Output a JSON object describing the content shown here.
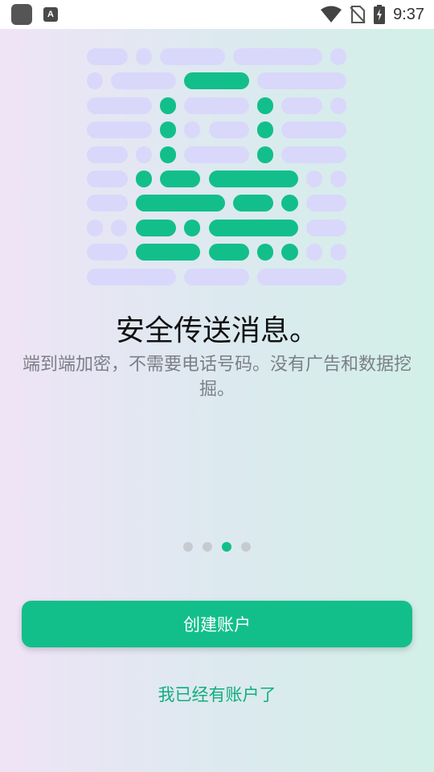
{
  "status_bar": {
    "time": "9:37",
    "icons": [
      "app-icon",
      "accessibility-icon",
      "wifi-icon",
      "no-sim-icon",
      "battery-charging-icon"
    ],
    "app_badge": "A"
  },
  "colors": {
    "accent": "#12bf8a",
    "light_pill": "#d9d8fb",
    "title": "#111111",
    "subtitle": "#7b7f87",
    "dot_inactive": "#c6cbd1"
  },
  "illustration": {
    "icon": "message-grid-illustration",
    "rows": [
      [
        {
          "s": "L",
          "w": 2
        },
        {
          "s": "L",
          "w": 1
        },
        {
          "s": "L",
          "w": 3
        },
        {
          "s": "L",
          "w": 4
        },
        {
          "s": "L",
          "w": 1
        }
      ],
      [
        {
          "s": "L",
          "w": 1
        },
        {
          "s": "L",
          "w": 3
        },
        {
          "s": "G",
          "w": 3
        },
        {
          "s": "L",
          "w": 4
        }
      ],
      [
        {
          "s": "L",
          "w": 3
        },
        {
          "s": "G",
          "w": 1
        },
        {
          "s": "L",
          "w": 3
        },
        {
          "s": "G",
          "w": 1
        },
        {
          "s": "L",
          "w": 2
        },
        {
          "s": "L",
          "w": 1
        }
      ],
      [
        {
          "s": "L",
          "w": 3
        },
        {
          "s": "G",
          "w": 1
        },
        {
          "s": "L",
          "w": 1
        },
        {
          "s": "L",
          "w": 2
        },
        {
          "s": "G",
          "w": 1
        },
        {
          "s": "L",
          "w": 3
        }
      ],
      [
        {
          "s": "L",
          "w": 2
        },
        {
          "s": "L",
          "w": 1
        },
        {
          "s": "G",
          "w": 1
        },
        {
          "s": "L",
          "w": 3
        },
        {
          "s": "G",
          "w": 1
        },
        {
          "s": "L",
          "w": 3
        }
      ],
      [
        {
          "s": "L",
          "w": 2
        },
        {
          "s": "G",
          "w": 1
        },
        {
          "s": "G",
          "w": 2
        },
        {
          "s": "G",
          "w": 4
        },
        {
          "s": "L",
          "w": 1
        },
        {
          "s": "L",
          "w": 1
        }
      ],
      [
        {
          "s": "L",
          "w": 2
        },
        {
          "s": "G",
          "w": 4
        },
        {
          "s": "G",
          "w": 2
        },
        {
          "s": "G",
          "w": 1
        },
        {
          "s": "L",
          "w": 2
        }
      ],
      [
        {
          "s": "L",
          "w": 1
        },
        {
          "s": "L",
          "w": 1
        },
        {
          "s": "G",
          "w": 2
        },
        {
          "s": "G",
          "w": 1
        },
        {
          "s": "G",
          "w": 4
        },
        {
          "s": "L",
          "w": 2
        }
      ],
      [
        {
          "s": "L",
          "w": 2
        },
        {
          "s": "G",
          "w": 3
        },
        {
          "s": "G",
          "w": 2
        },
        {
          "s": "G",
          "w": 1
        },
        {
          "s": "G",
          "w": 1
        },
        {
          "s": "L",
          "w": 1
        },
        {
          "s": "L",
          "w": 1
        }
      ],
      [
        {
          "s": "L",
          "w": 4
        },
        {
          "s": "L",
          "w": 3
        },
        {
          "s": "L",
          "w": 4
        }
      ]
    ]
  },
  "onboarding": {
    "title": "安全传送消息。",
    "subtitle": "端到端加密，不需要电话号码。没有广告和数据挖掘。",
    "page_count": 4,
    "active_page": 3
  },
  "actions": {
    "create_account": "创建账户",
    "have_account": "我已经有账户了"
  }
}
